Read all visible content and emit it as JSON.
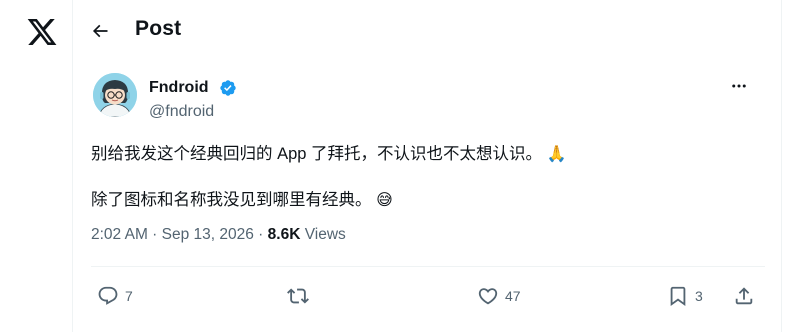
{
  "header": {
    "title": "Post"
  },
  "tweet": {
    "author": {
      "name": "Fndroid",
      "handle": "@fndroid",
      "verified": true
    },
    "text_line1": "别给我发这个经典回归的 App 了拜托，不认识也不太想认识。",
    "emoji1": "🙏",
    "text_line2": "除了图标和名称我没见到哪里有经典。",
    "emoji2": "😅",
    "timestamp": "2:02 AM · Sep 13, 2026",
    "separator": " · ",
    "views_count": "8.6K",
    "views_label": "Views"
  },
  "actions": {
    "replies": "7",
    "retweets": "",
    "likes": "47",
    "bookmarks": "3"
  },
  "colors": {
    "text": "#0f1419",
    "muted": "#536471",
    "verified": "#1d9bf0",
    "border": "#eff3f4"
  }
}
